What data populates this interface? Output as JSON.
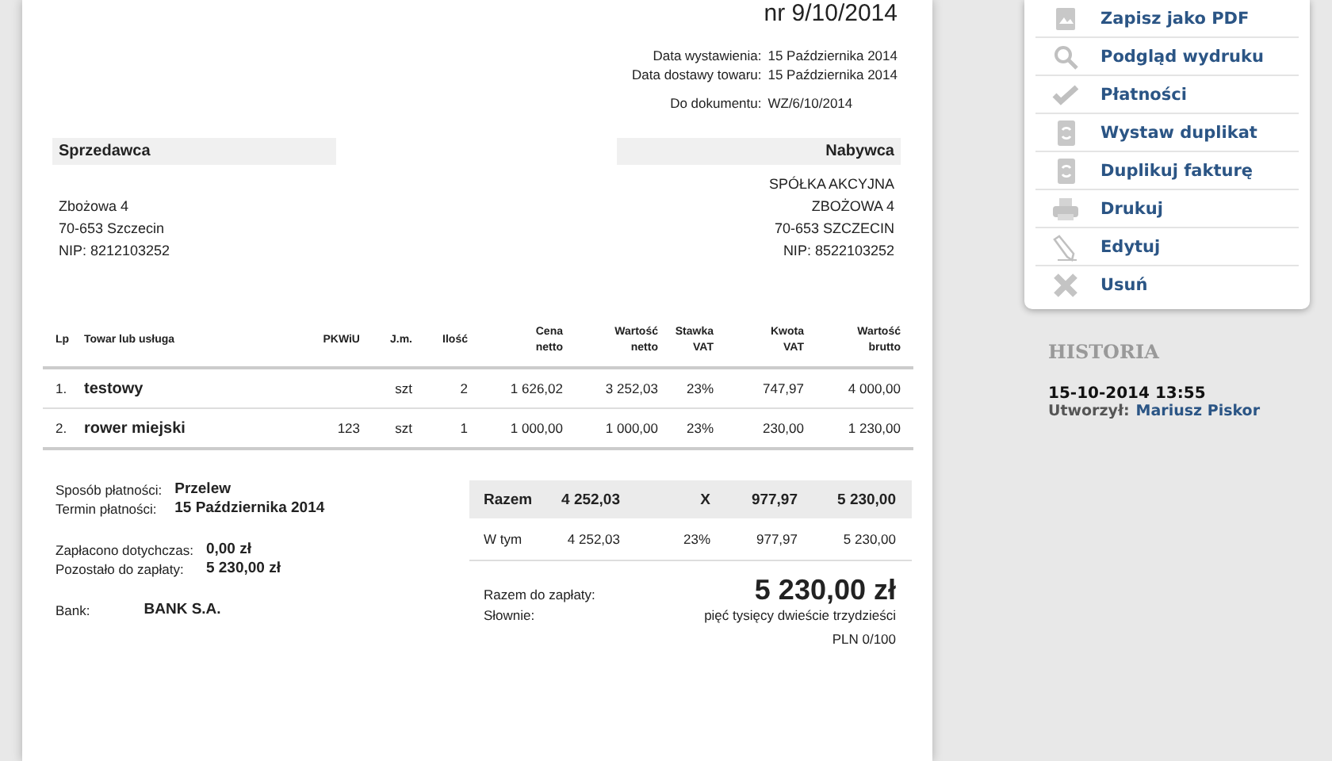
{
  "invoice": {
    "title": "nr 9/10/2014",
    "dates": [
      {
        "label": "Data wystawienia:",
        "value": "15 Października 2014"
      },
      {
        "label": "Data dostawy towaru:",
        "value": "15 Października 2014"
      }
    ],
    "reference": {
      "label": "Do dokumentu:",
      "value": "WZ/6/10/2014"
    },
    "seller": {
      "heading": "Sprzedawca",
      "lines": [
        "Zbożowa 4",
        "70-653 Szczecin",
        "NIP: 8212103252"
      ]
    },
    "buyer": {
      "heading": "Nabywca",
      "lines": [
        "SPÓŁKA AKCYJNA",
        "ZBOŻOWA 4",
        "70-653 SZCZECIN",
        "NIP: 8522103252"
      ]
    },
    "table": {
      "columns": [
        "Lp",
        "Towar lub usługa",
        "PKWiU",
        "J.m.",
        "Ilość",
        "Cena\nnetto",
        "Wartość\nnetto",
        "Stawka\nVAT",
        "Kwota\nVAT",
        "Wartość\nbrutto"
      ],
      "rows": [
        [
          "1.",
          "testowy",
          "",
          "szt",
          "2",
          "1 626,02",
          "3 252,03",
          "23%",
          "747,97",
          "4 000,00"
        ],
        [
          "2.",
          "rower miejski",
          "123",
          "szt",
          "1",
          "1 000,00",
          "1 000,00",
          "23%",
          "230,00",
          "1 230,00"
        ]
      ]
    },
    "payment": [
      [
        {
          "label": "Sposób płatności:",
          "value": "Przelew"
        },
        {
          "label": "Termin płatności:",
          "value": "15 Października 2014"
        }
      ],
      [
        {
          "label": "Zapłacono dotychczas:",
          "value": "0,00 zł"
        },
        {
          "label": "Pozostało do zapłaty:",
          "value": "5 230,00 zł"
        }
      ],
      [
        {
          "label": "Bank:",
          "value": "BANK S.A."
        }
      ]
    ],
    "summary": {
      "total_row": [
        "Razem",
        "4 252,03",
        "X",
        "977,97",
        "5 230,00"
      ],
      "subtotal_row": [
        "W tym",
        "4 252,03",
        "23%",
        "977,97",
        "5 230,00"
      ],
      "to_pay": {
        "label": "Razem do zapłaty:",
        "value": "5 230,00 zł"
      },
      "in_words": {
        "label": "Słownie:",
        "value": "pięć tysięcy dwieście trzydzieści",
        "currency": "PLN 0/100"
      }
    }
  },
  "sidebar": {
    "menu": [
      {
        "kind": "pdf",
        "label": "Zapisz jako PDF"
      },
      {
        "kind": "preview",
        "label": "Podgląd wydruku"
      },
      {
        "kind": "payments",
        "label": "Płatności"
      },
      {
        "kind": "duplicate",
        "label": "Wystaw duplikat"
      },
      {
        "kind": "duplicate",
        "label": "Duplikuj fakturę"
      },
      {
        "kind": "print",
        "label": "Drukuj"
      },
      {
        "kind": "edit",
        "label": "Edytuj"
      },
      {
        "kind": "delete",
        "label": "Usuń"
      }
    ],
    "history": {
      "heading": "HISTORIA",
      "entries": [
        {
          "time": "15-10-2014 13:55",
          "author_label": "Utworzył:",
          "author": "Mariusz Piskor"
        }
      ]
    }
  }
}
